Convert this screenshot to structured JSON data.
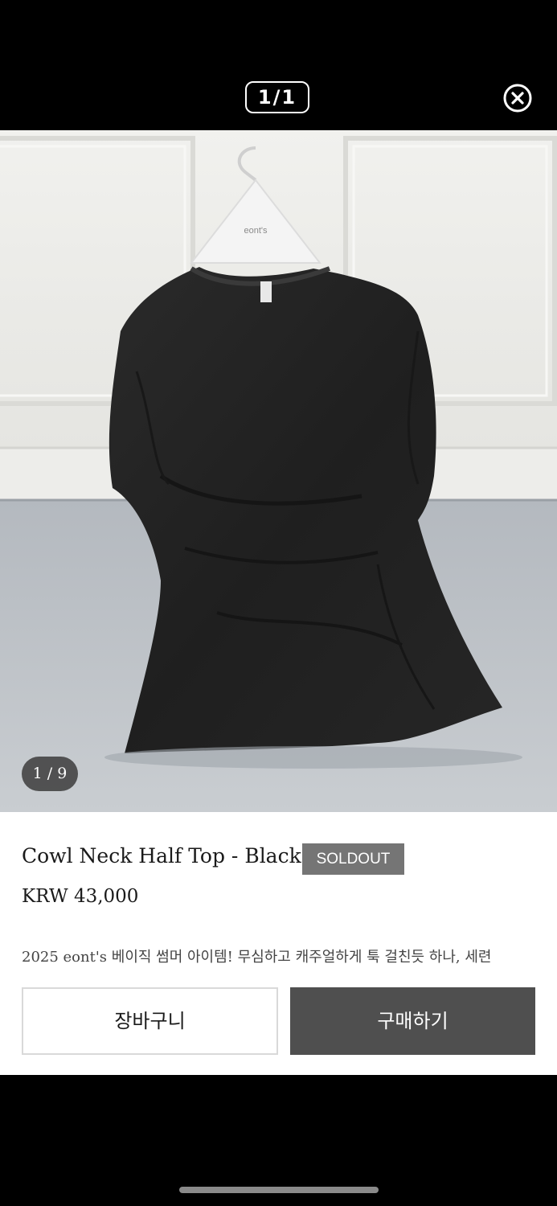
{
  "viewer": {
    "page_counter": "1/1",
    "close_label": "close"
  },
  "photo": {
    "hanger_text": "eont's",
    "image_counter": "1 / 9"
  },
  "product": {
    "title": "Cowl Neck Half Top - Black",
    "status_badge": "SOLDOUT",
    "price": "KRW 43,000",
    "description": "2025 eont's 베이직 썸머 아이템! 무심하고 캐주얼하게 툭 걸친듯 하나, 세련"
  },
  "actions": {
    "cart_label": "장바구니",
    "buy_label": "구매하기"
  },
  "colors": {
    "badge": "#757575",
    "buy_button": "#4f4f4f",
    "background": "#000000"
  }
}
